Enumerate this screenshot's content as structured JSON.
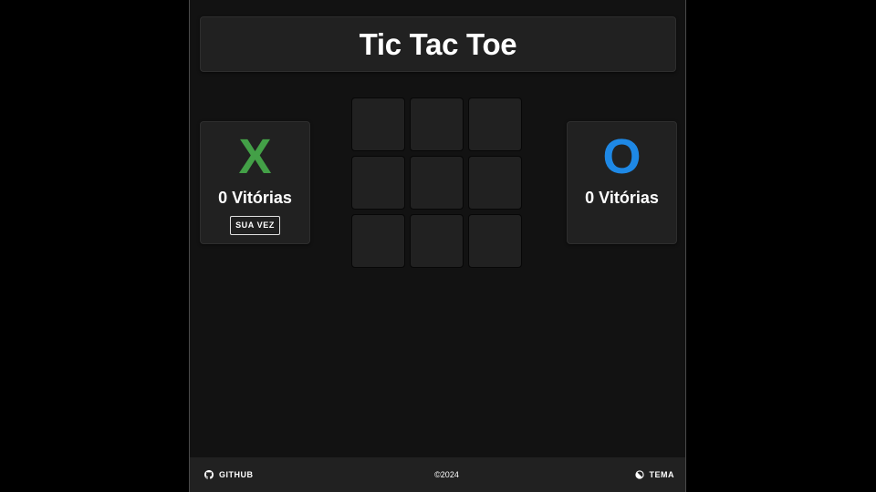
{
  "header": {
    "title": "Tic Tac Toe"
  },
  "players": [
    {
      "symbol": "X",
      "symbol_color": "#43a047",
      "wins_label": "0 Vitórias",
      "turn_label": "SUA VEZ",
      "is_turn": true
    },
    {
      "symbol": "O",
      "symbol_color": "#1e88e5",
      "wins_label": "0 Vitórias",
      "is_turn": false
    }
  ],
  "board": {
    "cells": [
      "",
      "",
      "",
      "",
      "",
      "",
      "",
      "",
      ""
    ]
  },
  "footer": {
    "github_label": "GITHUB",
    "github_icon": "github-icon",
    "copyright": "©2024",
    "theme_label": "TEMA",
    "theme_icon": "theme-icon"
  }
}
